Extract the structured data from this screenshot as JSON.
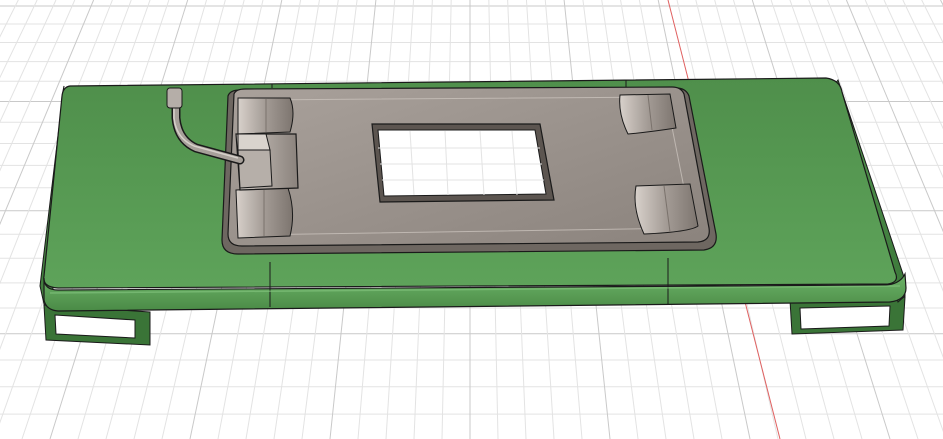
{
  "viewport": {
    "label": "",
    "background_color": "#ffffff"
  },
  "grid": {
    "visible": true,
    "minor_color": "#e3e3e3",
    "major_color": "#c9c9c9",
    "axis_color": "#e06060"
  },
  "model": {
    "base_color": "#5fa05a",
    "base_dark_color": "#3d7a3a",
    "base_shadow_color": "#2f5f2d",
    "plate_color": "#9d958f",
    "plate_light_color": "#c3bcb6",
    "plate_dark_color": "#6f6862",
    "edge_color": "#1a1a1a",
    "cutout_color": "#ffffff"
  },
  "objects": [
    {
      "id": "base",
      "icon": "base-body"
    },
    {
      "id": "plate",
      "icon": "plate-body"
    },
    {
      "id": "wire",
      "icon": "wire-body"
    }
  ]
}
